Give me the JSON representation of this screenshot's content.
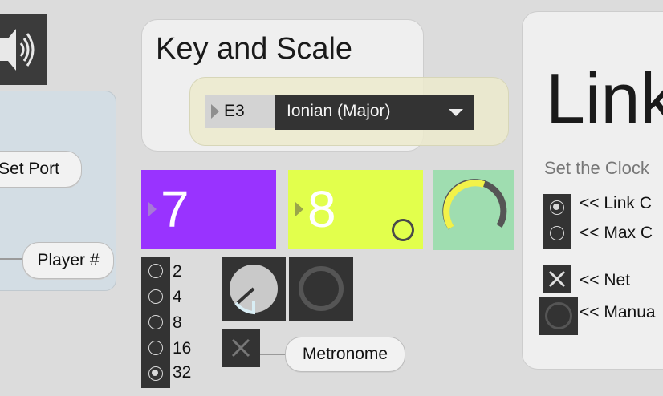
{
  "speaker": {
    "icon": "speaker-icon"
  },
  "left_panel": {
    "set_port_label": "Set Port",
    "player_label": "Player #"
  },
  "key_scale": {
    "title": "Key and Scale",
    "note_value": "E3",
    "scale_value": "Ionian (Major)"
  },
  "number_boxes": [
    {
      "value": "7",
      "color": "#9933ff"
    },
    {
      "value": "8",
      "color": "#e2ff4c"
    }
  ],
  "dial": {
    "color": "#9fddb0",
    "accent": "#f2f24a"
  },
  "subdivisions": {
    "options": [
      "2",
      "4",
      "8",
      "16",
      "32"
    ],
    "selected": "32"
  },
  "metronome": {
    "label": "Metronome",
    "checked": true
  },
  "link_panel": {
    "title": "Link",
    "subtitle": "Set the Clock",
    "clock_options": [
      "<< Link C",
      "<< Max C"
    ],
    "clock_selected": "<< Link C",
    "net_label": "<< Net",
    "manual_label": "<< Manua"
  }
}
